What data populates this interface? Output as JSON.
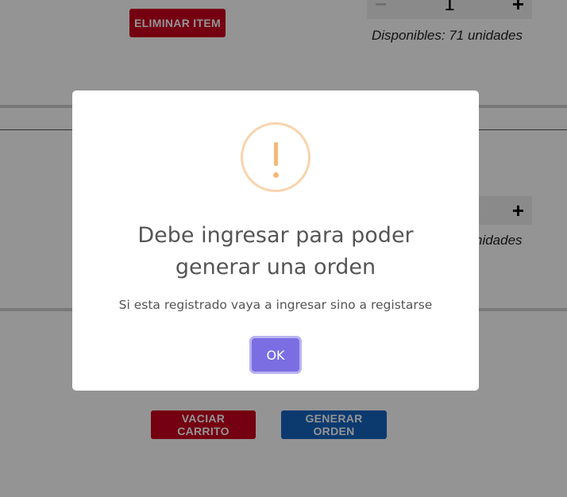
{
  "cart": {
    "items": [
      {
        "quantity": "1",
        "stock_text": "Disponibles: 71 unidades",
        "remove_label": "ELIMINAR ITEM",
        "minus_symbol": "−",
        "plus_symbol": "+"
      },
      {
        "stock_text_visible": "nidades",
        "plus_symbol": "+"
      }
    ],
    "empty_cart_label": "VACIAR CARRITO",
    "generate_order_label": "GENERAR ORDEN"
  },
  "modal": {
    "icon": "warning-icon",
    "title_line1": "Debe ingresar para poder",
    "title_line2": "generar una orden",
    "text": "Si esta registrado vaya a ingresar sino a registarse",
    "ok_label": "OK"
  },
  "colors": {
    "danger": "#c8001e",
    "primary": "#1565c0",
    "warning_icon": "#f8bb86",
    "ok_button": "#7b6ee2"
  }
}
